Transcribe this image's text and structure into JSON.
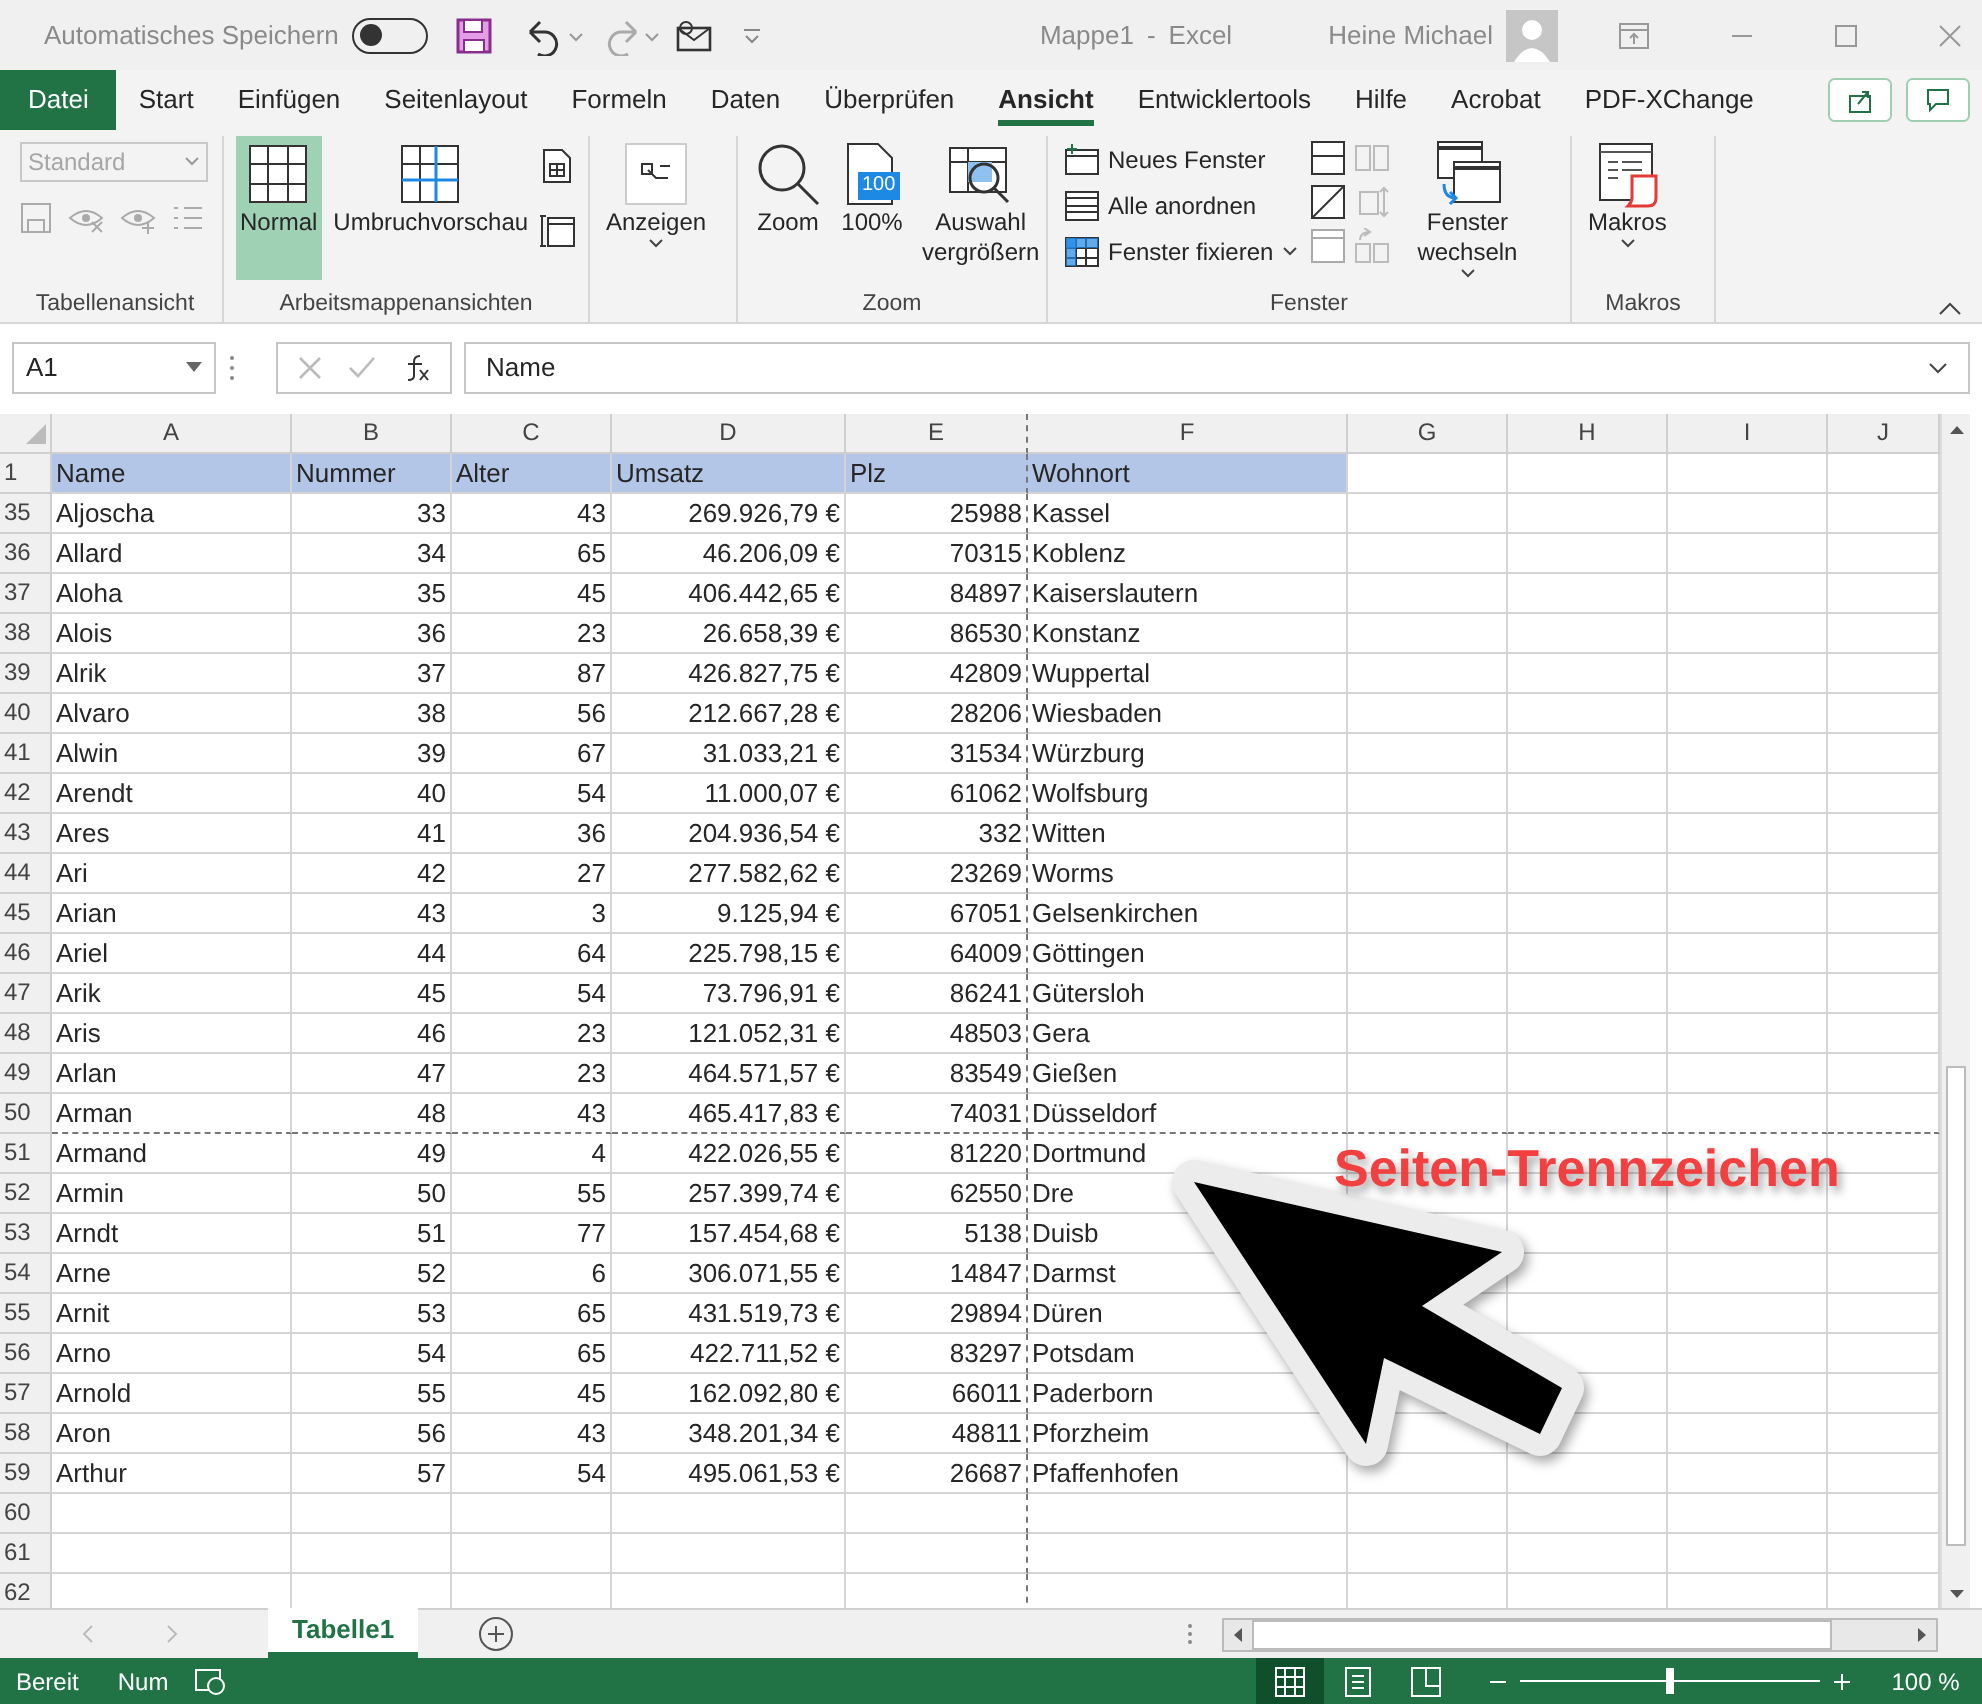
{
  "title_bar": {
    "autosave_label": "Automatisches Speichern",
    "autosave_on": false,
    "document": "Mappe1",
    "separator": "-",
    "app": "Excel",
    "user": "Heine Michael"
  },
  "ribbon_tabs": [
    {
      "label": "Datei",
      "kind": "file",
      "selected": false
    },
    {
      "label": "Start",
      "kind": "tab",
      "selected": false
    },
    {
      "label": "Einfügen",
      "kind": "tab",
      "selected": false
    },
    {
      "label": "Seitenlayout",
      "kind": "tab",
      "selected": false
    },
    {
      "label": "Formeln",
      "kind": "tab",
      "selected": false
    },
    {
      "label": "Daten",
      "kind": "tab",
      "selected": false
    },
    {
      "label": "Überprüfen",
      "kind": "tab",
      "selected": false
    },
    {
      "label": "Ansicht",
      "kind": "tab",
      "selected": true
    },
    {
      "label": "Entwicklertools",
      "kind": "tab",
      "selected": false
    },
    {
      "label": "Hilfe",
      "kind": "tab",
      "selected": false
    },
    {
      "label": "Acrobat",
      "kind": "tab",
      "selected": false
    },
    {
      "label": "PDF-XChange",
      "kind": "tab",
      "selected": false
    }
  ],
  "ribbon": {
    "sheet_view": {
      "title": "Tabellenansicht",
      "dropdown": "Standard",
      "disabled": true
    },
    "workbook_views": {
      "title": "Arbeitsmappenansichten",
      "items": [
        {
          "label": "Normal",
          "selected": true
        },
        {
          "label": "Umbruchvorschau",
          "selected": false
        }
      ]
    },
    "show": {
      "label": "Anzeigen"
    },
    "zoom": {
      "title": "Zoom",
      "zoom": "Zoom",
      "hundred": "100%",
      "hundred_badge": "100",
      "selection": "Auswahl vergrößern"
    },
    "window": {
      "title": "Fenster",
      "new_window": "Neues Fenster",
      "arrange": "Alle anordnen",
      "freeze": "Fenster fixieren",
      "switch": "Fenster wechseln"
    },
    "macros": {
      "title": "Makros",
      "label": "Makros"
    }
  },
  "formula_bar": {
    "name_box": "A1",
    "formula": "Name"
  },
  "sheet": {
    "columns": [
      {
        "label": "A",
        "kind": "text",
        "page_break": false
      },
      {
        "label": "B",
        "kind": "number",
        "page_break": false
      },
      {
        "label": "C",
        "kind": "number",
        "page_break": false
      },
      {
        "label": "D",
        "kind": "number",
        "page_break": false
      },
      {
        "label": "E",
        "kind": "number",
        "page_break": true
      },
      {
        "label": "F",
        "kind": "text",
        "page_break": false
      },
      {
        "label": "G",
        "kind": "text",
        "page_break": false
      },
      {
        "label": "H",
        "kind": "text",
        "page_break": false
      },
      {
        "label": "I",
        "kind": "text",
        "page_break": false
      },
      {
        "label": "J",
        "kind": "text",
        "page_break": false
      }
    ],
    "rows": [
      {
        "number": "1",
        "kind": "header",
        "page_break": false,
        "cells": [
          "Name",
          "Nummer",
          "Alter",
          "Umsatz",
          "Plz",
          "Wohnort"
        ]
      },
      {
        "number": "35",
        "kind": "data",
        "page_break": false,
        "cells": [
          "Aljoscha",
          "33",
          "43",
          "269.926,79 €",
          "25988",
          "Kassel"
        ]
      },
      {
        "number": "36",
        "kind": "data",
        "page_break": false,
        "cells": [
          "Allard",
          "34",
          "65",
          "46.206,09 €",
          "70315",
          "Koblenz"
        ]
      },
      {
        "number": "37",
        "kind": "data",
        "page_break": false,
        "cells": [
          "Aloha",
          "35",
          "45",
          "406.442,65 €",
          "84897",
          "Kaiserslautern"
        ]
      },
      {
        "number": "38",
        "kind": "data",
        "page_break": false,
        "cells": [
          "Alois",
          "36",
          "23",
          "26.658,39 €",
          "86530",
          "Konstanz"
        ]
      },
      {
        "number": "39",
        "kind": "data",
        "page_break": false,
        "cells": [
          "Alrik",
          "37",
          "87",
          "426.827,75 €",
          "42809",
          "Wuppertal"
        ]
      },
      {
        "number": "40",
        "kind": "data",
        "page_break": false,
        "cells": [
          "Alvaro",
          "38",
          "56",
          "212.667,28 €",
          "28206",
          "Wiesbaden"
        ]
      },
      {
        "number": "41",
        "kind": "data",
        "page_break": false,
        "cells": [
          "Alwin",
          "39",
          "67",
          "31.033,21 €",
          "31534",
          "Würzburg"
        ]
      },
      {
        "number": "42",
        "kind": "data",
        "page_break": false,
        "cells": [
          "Arendt",
          "40",
          "54",
          "11.000,07 €",
          "61062",
          "Wolfsburg"
        ]
      },
      {
        "number": "43",
        "kind": "data",
        "page_break": false,
        "cells": [
          "Ares",
          "41",
          "36",
          "204.936,54 €",
          "332",
          "Witten"
        ]
      },
      {
        "number": "44",
        "kind": "data",
        "page_break": false,
        "cells": [
          "Ari",
          "42",
          "27",
          "277.582,62 €",
          "23269",
          "Worms"
        ]
      },
      {
        "number": "45",
        "kind": "data",
        "page_break": false,
        "cells": [
          "Arian",
          "43",
          "3",
          "9.125,94 €",
          "67051",
          "Gelsenkirchen"
        ]
      },
      {
        "number": "46",
        "kind": "data",
        "page_break": false,
        "cells": [
          "Ariel",
          "44",
          "64",
          "225.798,15 €",
          "64009",
          "Göttingen"
        ]
      },
      {
        "number": "47",
        "kind": "data",
        "page_break": false,
        "cells": [
          "Arik",
          "45",
          "54",
          "73.796,91 €",
          "86241",
          "Gütersloh"
        ]
      },
      {
        "number": "48",
        "kind": "data",
        "page_break": false,
        "cells": [
          "Aris",
          "46",
          "23",
          "121.052,31 €",
          "48503",
          "Gera"
        ]
      },
      {
        "number": "49",
        "kind": "data",
        "page_break": false,
        "cells": [
          "Arlan",
          "47",
          "23",
          "464.571,57 €",
          "83549",
          "Gießen"
        ]
      },
      {
        "number": "50",
        "kind": "data",
        "page_break": true,
        "cells": [
          "Arman",
          "48",
          "43",
          "465.417,83 €",
          "74031",
          "Düsseldorf"
        ]
      },
      {
        "number": "51",
        "kind": "data",
        "page_break": false,
        "cells": [
          "Armand",
          "49",
          "4",
          "422.026,55 €",
          "81220",
          "Dortmund"
        ]
      },
      {
        "number": "52",
        "kind": "data",
        "page_break": false,
        "cells": [
          "Armin",
          "50",
          "55",
          "257.399,74 €",
          "62550",
          "Dre"
        ]
      },
      {
        "number": "53",
        "kind": "data",
        "page_break": false,
        "cells": [
          "Arndt",
          "51",
          "77",
          "157.454,68 €",
          "5138",
          "Duisb"
        ]
      },
      {
        "number": "54",
        "kind": "data",
        "page_break": false,
        "cells": [
          "Arne",
          "52",
          "6",
          "306.071,55 €",
          "14847",
          "Darmst"
        ]
      },
      {
        "number": "55",
        "kind": "data",
        "page_break": false,
        "cells": [
          "Arnit",
          "53",
          "65",
          "431.519,73 €",
          "29894",
          "Düren"
        ]
      },
      {
        "number": "56",
        "kind": "data",
        "page_break": false,
        "cells": [
          "Arno",
          "54",
          "65",
          "422.711,52 €",
          "83297",
          "Potsdam"
        ]
      },
      {
        "number": "57",
        "kind": "data",
        "page_break": false,
        "cells": [
          "Arnold",
          "55",
          "45",
          "162.092,80 €",
          "66011",
          "Paderborn"
        ]
      },
      {
        "number": "58",
        "kind": "data",
        "page_break": false,
        "cells": [
          "Aron",
          "56",
          "43",
          "348.201,34 €",
          "48811",
          "Pforzheim"
        ]
      },
      {
        "number": "59",
        "kind": "data",
        "page_break": false,
        "cells": [
          "Arthur",
          "57",
          "54",
          "495.061,53 €",
          "26687",
          "Pfaffenhofen"
        ]
      },
      {
        "number": "60",
        "kind": "empty",
        "page_break": false
      },
      {
        "number": "61",
        "kind": "empty",
        "page_break": false
      },
      {
        "number": "62",
        "kind": "empty",
        "page_break": false
      }
    ]
  },
  "annotation": {
    "text": "Seiten-Trennzeichen"
  },
  "sheet_tabs": [
    {
      "label": "Tabelle1",
      "selected": true
    }
  ],
  "status_bar": {
    "mode": "Bereit",
    "num": "Num",
    "views": [
      {
        "kind": "normal",
        "selected": true
      },
      {
        "kind": "page_layout",
        "selected": false
      },
      {
        "kind": "page_break",
        "selected": false
      }
    ],
    "zoom": {
      "level": 0.5,
      "reading": "100 %"
    }
  }
}
